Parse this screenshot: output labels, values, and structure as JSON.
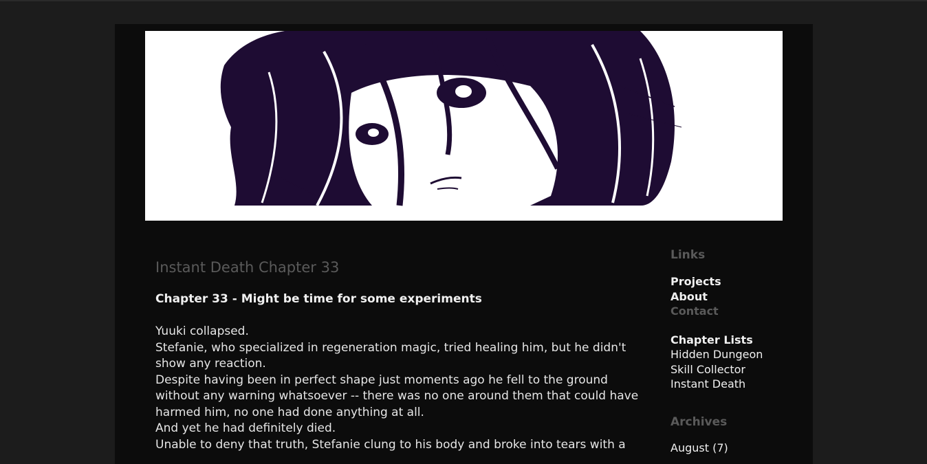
{
  "header": {
    "banner_image": "manga-girl-face-banner"
  },
  "post": {
    "title": "Instant Death Chapter 33",
    "chapter_heading": "Chapter 33 - Might be time for some experiments",
    "paragraphs": [
      "Yuuki collapsed.",
      "Stefanie, who specialized in regeneration magic, tried healing him, but he didn't show any reaction.",
      "Despite having been in perfect shape just moments ago he fell to the ground without any warning whatsoever -- there was no one around them that could have harmed him, no one had done anything at all.",
      "And yet he had definitely died.",
      "Unable to deny that truth, Stefanie clung to his body and broke into tears with a"
    ]
  },
  "sidebar": {
    "links_heading": "Links",
    "links": [
      "Projects",
      "About",
      "Contact"
    ],
    "chapter_lists_heading": "Chapter Lists",
    "chapter_lists": [
      "Hidden Dungeon",
      "Skill Collector",
      "Instant Death"
    ],
    "archives_heading": "Archives",
    "archives": [
      "August (7)"
    ]
  }
}
